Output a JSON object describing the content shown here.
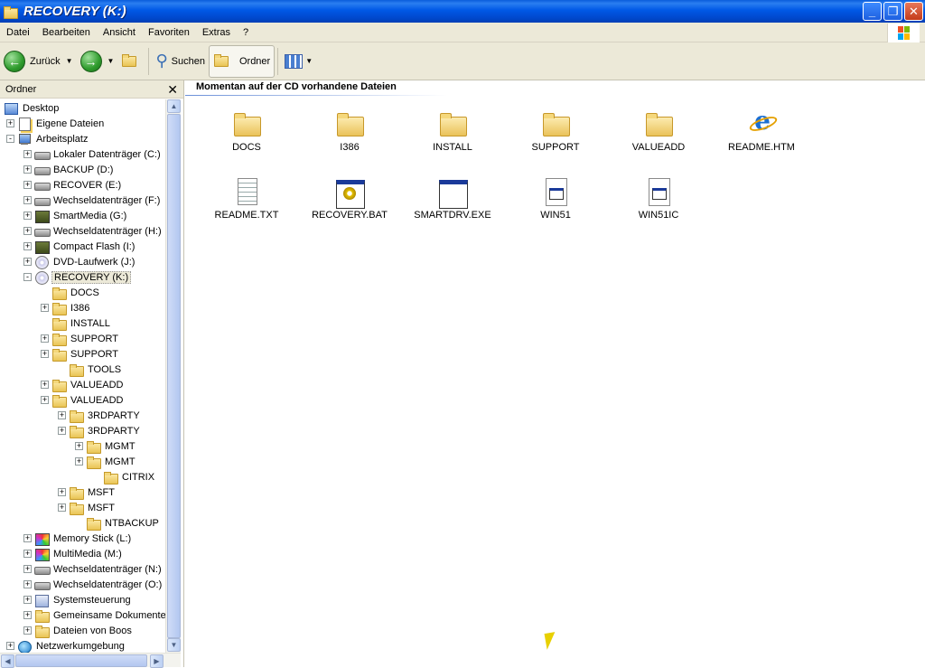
{
  "window": {
    "title": "RECOVERY (K:)"
  },
  "menubar": [
    "Datei",
    "Bearbeiten",
    "Ansicht",
    "Favoriten",
    "Extras",
    "?"
  ],
  "toolbar": {
    "back": "Zurück",
    "search": "Suchen",
    "folders": "Ordner"
  },
  "leftpane": {
    "header": "Ordner",
    "tree": [
      {
        "label": "Desktop",
        "icon": "desktop",
        "level": 0,
        "exp": "none"
      },
      {
        "label": "Eigene Dateien",
        "icon": "docs",
        "level": 1,
        "exp": "+"
      },
      {
        "label": "Arbeitsplatz",
        "icon": "pc",
        "level": 1,
        "exp": "-"
      },
      {
        "label": "Lokaler Datenträger (C:)",
        "icon": "drive",
        "level": 2,
        "exp": "+"
      },
      {
        "label": "BACKUP (D:)",
        "icon": "drive",
        "level": 2,
        "exp": "+"
      },
      {
        "label": "RECOVER (E:)",
        "icon": "drive",
        "level": 2,
        "exp": "+"
      },
      {
        "label": "Wechseldatenträger (F:)",
        "icon": "drive",
        "level": 2,
        "exp": "+"
      },
      {
        "label": "SmartMedia (G:)",
        "icon": "card",
        "level": 2,
        "exp": "+"
      },
      {
        "label": "Wechseldatenträger (H:)",
        "icon": "drive",
        "level": 2,
        "exp": "+"
      },
      {
        "label": "Compact Flash (I:)",
        "icon": "card",
        "level": 2,
        "exp": "+"
      },
      {
        "label": "DVD-Laufwerk (J:)",
        "icon": "cd",
        "level": 2,
        "exp": "+"
      },
      {
        "label": "RECOVERY (K:)",
        "icon": "cd",
        "level": 2,
        "exp": "-",
        "selected": true
      },
      {
        "label": "DOCS",
        "icon": "folder",
        "level": 3,
        "exp": "none"
      },
      {
        "label": "I386",
        "icon": "folder",
        "level": 3,
        "exp": "+"
      },
      {
        "label": "INSTALL",
        "icon": "folder",
        "level": 3,
        "exp": "none"
      },
      {
        "label": "SUPPORT",
        "icon": "folder",
        "level": 3,
        "exp": "+"
      },
      {
        "label": "SUPPORT",
        "icon": "folder",
        "level": 3,
        "exp": "+"
      },
      {
        "label": "TOOLS",
        "icon": "folder",
        "level": 4,
        "exp": "none"
      },
      {
        "label": "VALUEADD",
        "icon": "folder",
        "level": 3,
        "exp": "+"
      },
      {
        "label": "VALUEADD",
        "icon": "folder",
        "level": 3,
        "exp": "+"
      },
      {
        "label": "3RDPARTY",
        "icon": "folder",
        "level": 4,
        "exp": "+"
      },
      {
        "label": "3RDPARTY",
        "icon": "folder",
        "level": 4,
        "exp": "+"
      },
      {
        "label": "MGMT",
        "icon": "folder",
        "level": 5,
        "exp": "+"
      },
      {
        "label": "MGMT",
        "icon": "folder",
        "level": 5,
        "exp": "+"
      },
      {
        "label": "CITRIX",
        "icon": "folder",
        "level": 6,
        "exp": "none"
      },
      {
        "label": "MSFT",
        "icon": "folder",
        "level": 4,
        "exp": "+"
      },
      {
        "label": "MSFT",
        "icon": "folder",
        "level": 4,
        "exp": "+"
      },
      {
        "label": "NTBACKUP",
        "icon": "folder",
        "level": 5,
        "exp": "none"
      },
      {
        "label": "Memory Stick (L:)",
        "icon": "multi",
        "level": 2,
        "exp": "+"
      },
      {
        "label": "MultiMedia (M:)",
        "icon": "multi",
        "level": 2,
        "exp": "+"
      },
      {
        "label": "Wechseldatenträger (N:)",
        "icon": "drive",
        "level": 2,
        "exp": "+"
      },
      {
        "label": "Wechseldatenträger (O:)",
        "icon": "drive",
        "level": 2,
        "exp": "+"
      },
      {
        "label": "Systemsteuerung",
        "icon": "ctl",
        "level": 2,
        "exp": "+"
      },
      {
        "label": "Gemeinsame Dokumente",
        "icon": "folder",
        "level": 2,
        "exp": "+"
      },
      {
        "label": "Dateien von Boos",
        "icon": "folder",
        "level": 2,
        "exp": "+"
      },
      {
        "label": "Netzwerkumgebung",
        "icon": "net",
        "level": 1,
        "exp": "+"
      }
    ]
  },
  "main": {
    "section_title": "Momentan auf der CD vorhandene Dateien",
    "files": [
      {
        "name": "DOCS",
        "icon": "folder"
      },
      {
        "name": "I386",
        "icon": "folder"
      },
      {
        "name": "INSTALL",
        "icon": "folder"
      },
      {
        "name": "SUPPORT",
        "icon": "folder"
      },
      {
        "name": "VALUEADD",
        "icon": "folder"
      },
      {
        "name": "README.HTM",
        "icon": "htm"
      },
      {
        "name": "README.TXT",
        "icon": "txt"
      },
      {
        "name": "RECOVERY.BAT",
        "icon": "bat"
      },
      {
        "name": "SMARTDRV.EXE",
        "icon": "exe"
      },
      {
        "name": "WIN51",
        "icon": "sys"
      },
      {
        "name": "WIN51IC",
        "icon": "sys"
      }
    ]
  }
}
